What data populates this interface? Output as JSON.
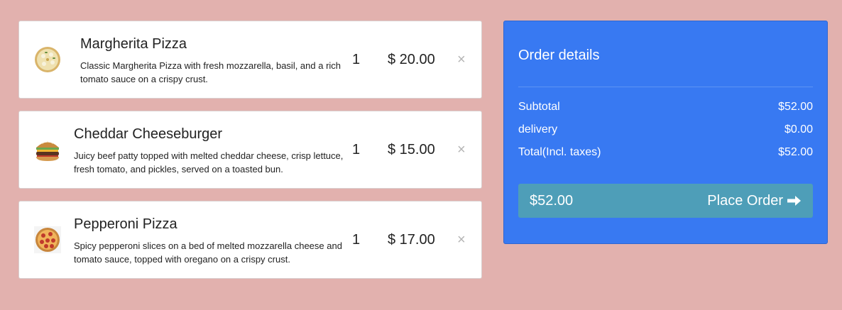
{
  "cart": {
    "items": [
      {
        "name": "Margherita Pizza",
        "description_line1": "Classic Margherita Pizza with fresh mozzarella, basil, and a rich",
        "description_line2": "tomato sauce on a crispy crust.",
        "quantity": "1",
        "price": "$ 20.00",
        "remove_glyph": "×",
        "image_icon": "margherita-pizza-image"
      },
      {
        "name": "Cheddar Cheeseburger",
        "description_line1": "Juicy beef patty topped with melted cheddar cheese, crisp lettuce,",
        "description_line2": "fresh tomato, and pickles, served on a toasted bun.",
        "quantity": "1",
        "price": "$ 15.00",
        "remove_glyph": "×",
        "image_icon": "cheeseburger-image"
      },
      {
        "name": "Pepperoni Pizza",
        "description_line1": "Spicy pepperoni slices on a bed of melted mozzarella cheese and",
        "description_line2": "tomato sauce, topped with oregano on a crispy crust.",
        "quantity": "1",
        "price": "$ 17.00",
        "remove_glyph": "×",
        "image_icon": "pepperoni-pizza-image"
      }
    ]
  },
  "order": {
    "title": "Order details",
    "subtotal_label": "Subtotal",
    "subtotal_value": "$52.00",
    "delivery_label": "delivery",
    "delivery_value": "$0.00",
    "total_label": "Total(Incl. taxes)",
    "total_value": "$52.00",
    "button_amount": "$52.00",
    "button_label": "Place Order",
    "button_icon": "arrow-right-icon"
  },
  "colors": {
    "background": "#e2b1ae",
    "panel": "#3879f2",
    "button": "#4e9eb8",
    "remove": "#b5b5b5"
  }
}
